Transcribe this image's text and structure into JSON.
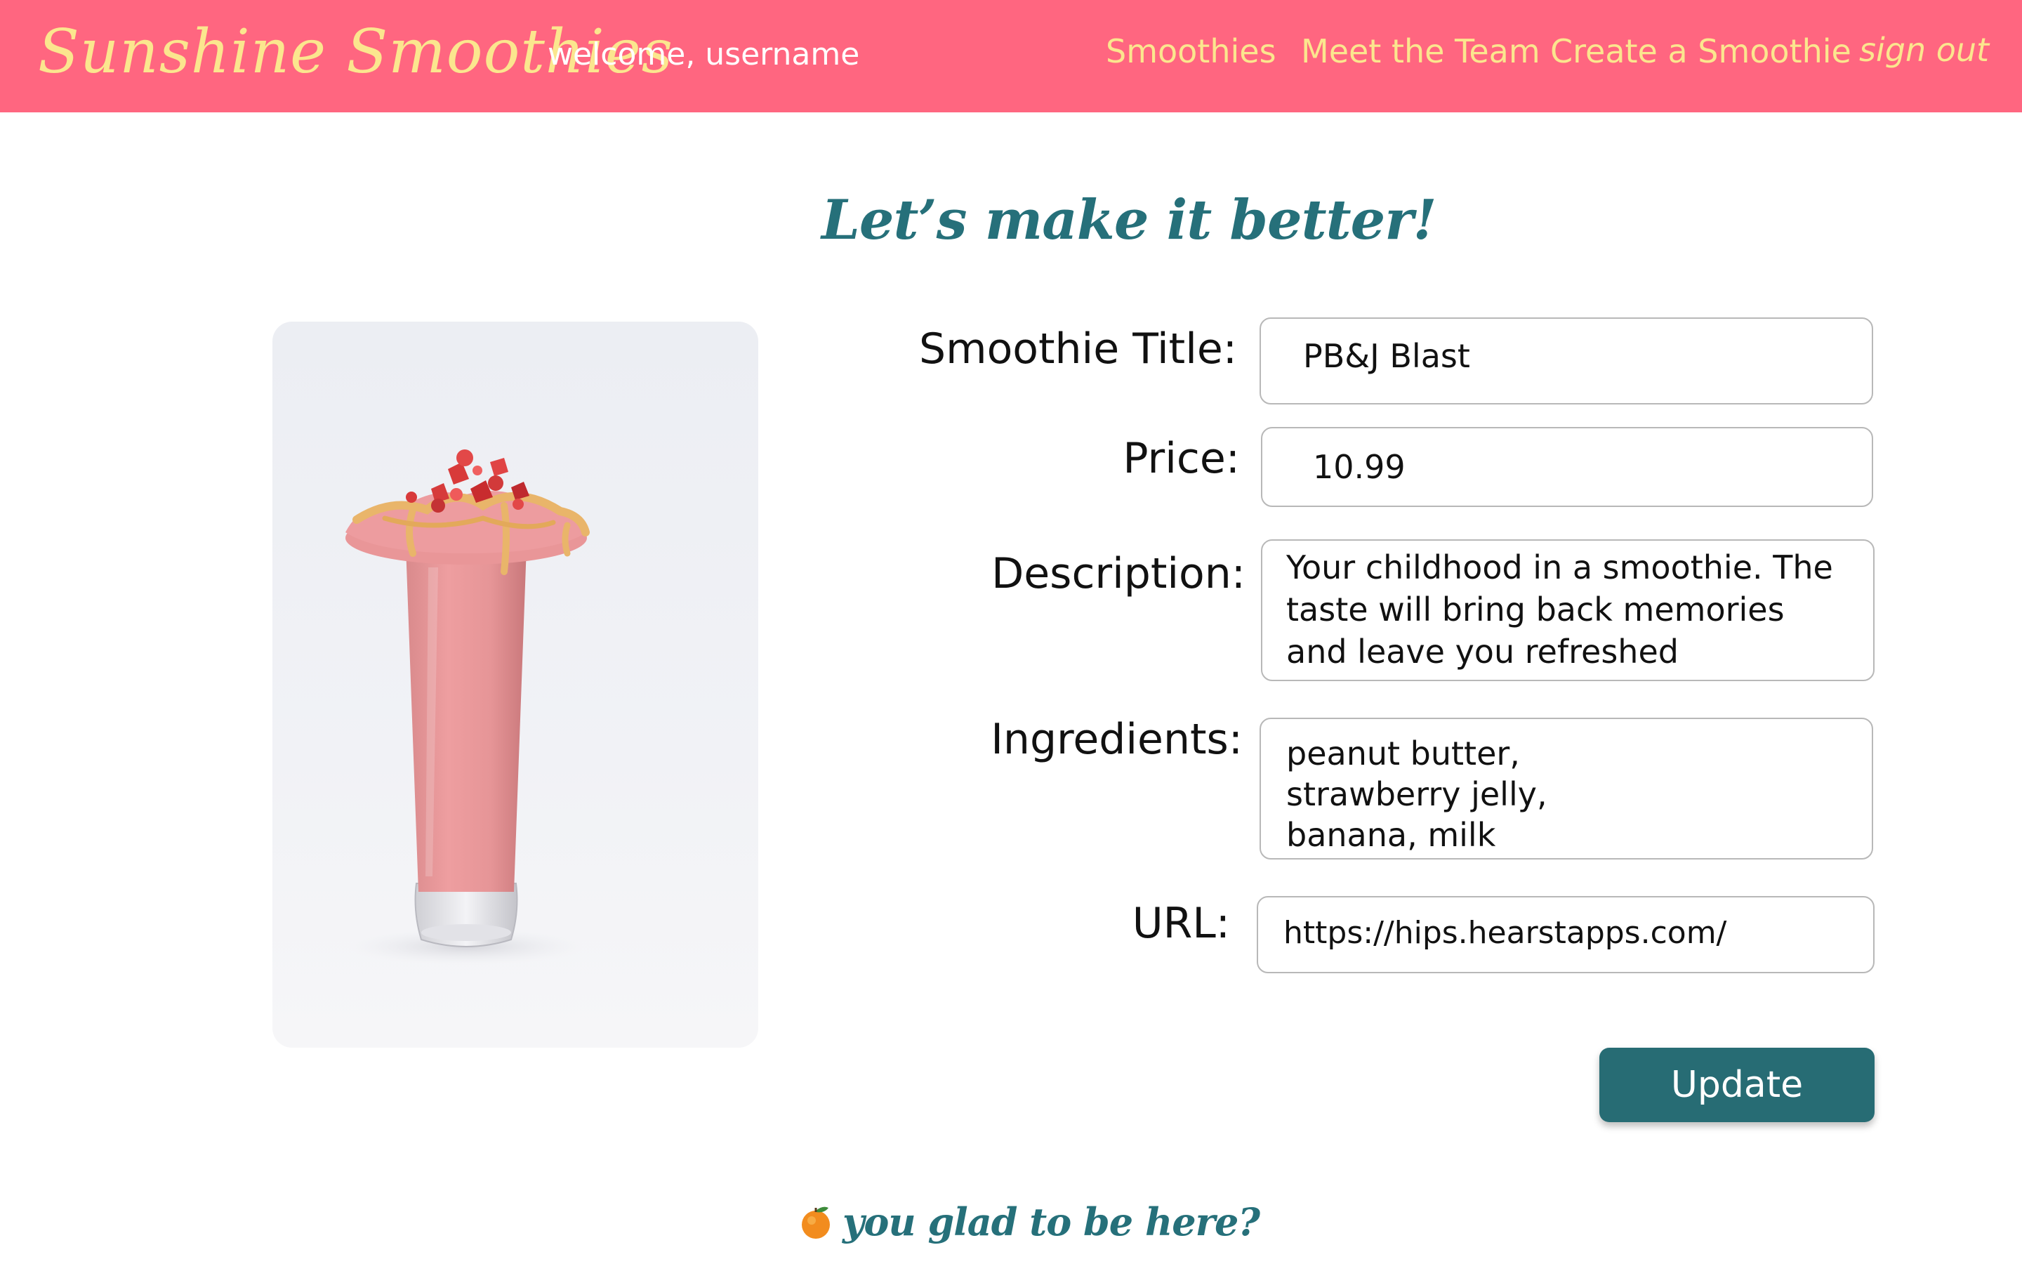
{
  "navbar": {
    "brand": "Sunshine Smoothies",
    "welcome": "welcome, username",
    "links": {
      "smoothies": "Smoothies",
      "team": "Meet the Team",
      "create": "Create a Smoothie",
      "signout": "sign out"
    }
  },
  "page": {
    "heading": "Let’s make it better!"
  },
  "image": {
    "icon": "smoothie-photo"
  },
  "form": {
    "title": {
      "label": "Smoothie Title:",
      "value": "PB&J Blast"
    },
    "price": {
      "label": "Price:",
      "value": "10.99"
    },
    "description": {
      "label": "Description:",
      "value": "Your childhood in a smoothie. The taste will bring back memories and leave you refreshed"
    },
    "ingredients": {
      "label": "Ingredients:",
      "value": "peanut butter,\nstrawberry jelly,\nbanana, milk"
    },
    "url": {
      "label": "URL:",
      "value": "https://hips.hearstapps.com/"
    },
    "submit": "Update"
  },
  "footer": {
    "text": "you glad to be here?",
    "icon": "orange-icon"
  },
  "colors": {
    "navbar_bg": "#ff6680",
    "nav_text": "#fbe68e",
    "accent_teal": "#26707a",
    "button_bg": "#276c74"
  }
}
